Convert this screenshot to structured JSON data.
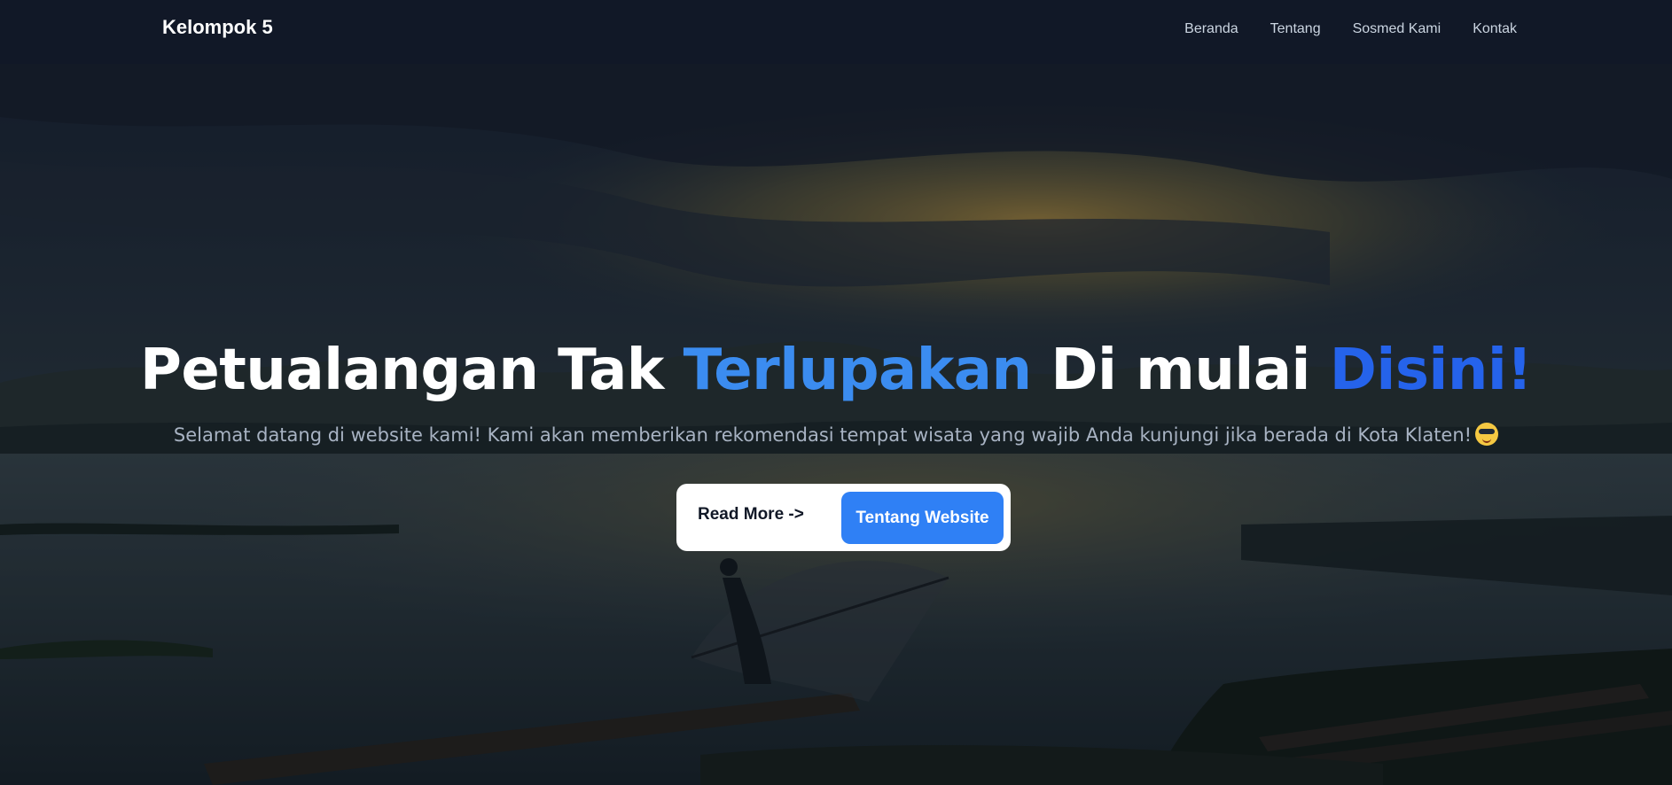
{
  "navbar": {
    "brand": "Kelompok 5",
    "links": [
      "Beranda",
      "Tentang",
      "Sosmed Kami",
      "Kontak"
    ]
  },
  "hero": {
    "title_part1": "Petualangan Tak ",
    "title_highlight1": "Terlupakan",
    "title_part2": " Di mulai ",
    "title_highlight2": "Disini!",
    "subtitle": "Selamat datang di website kami! Kami akan memberikan rekomendasi tempat wisata yang wajib Anda kunjungi jika berada di Kota Klaten!",
    "emoji_icon": "smiling-face-with-sunglasses-icon",
    "buttons": {
      "read_more": "Read More ->",
      "about": "Tentang Website"
    }
  },
  "colors": {
    "navbar_bg": "#111827",
    "highlight_light": "#3b8cf0",
    "highlight_dark": "#2563eb",
    "primary_button": "#2f80f5"
  }
}
